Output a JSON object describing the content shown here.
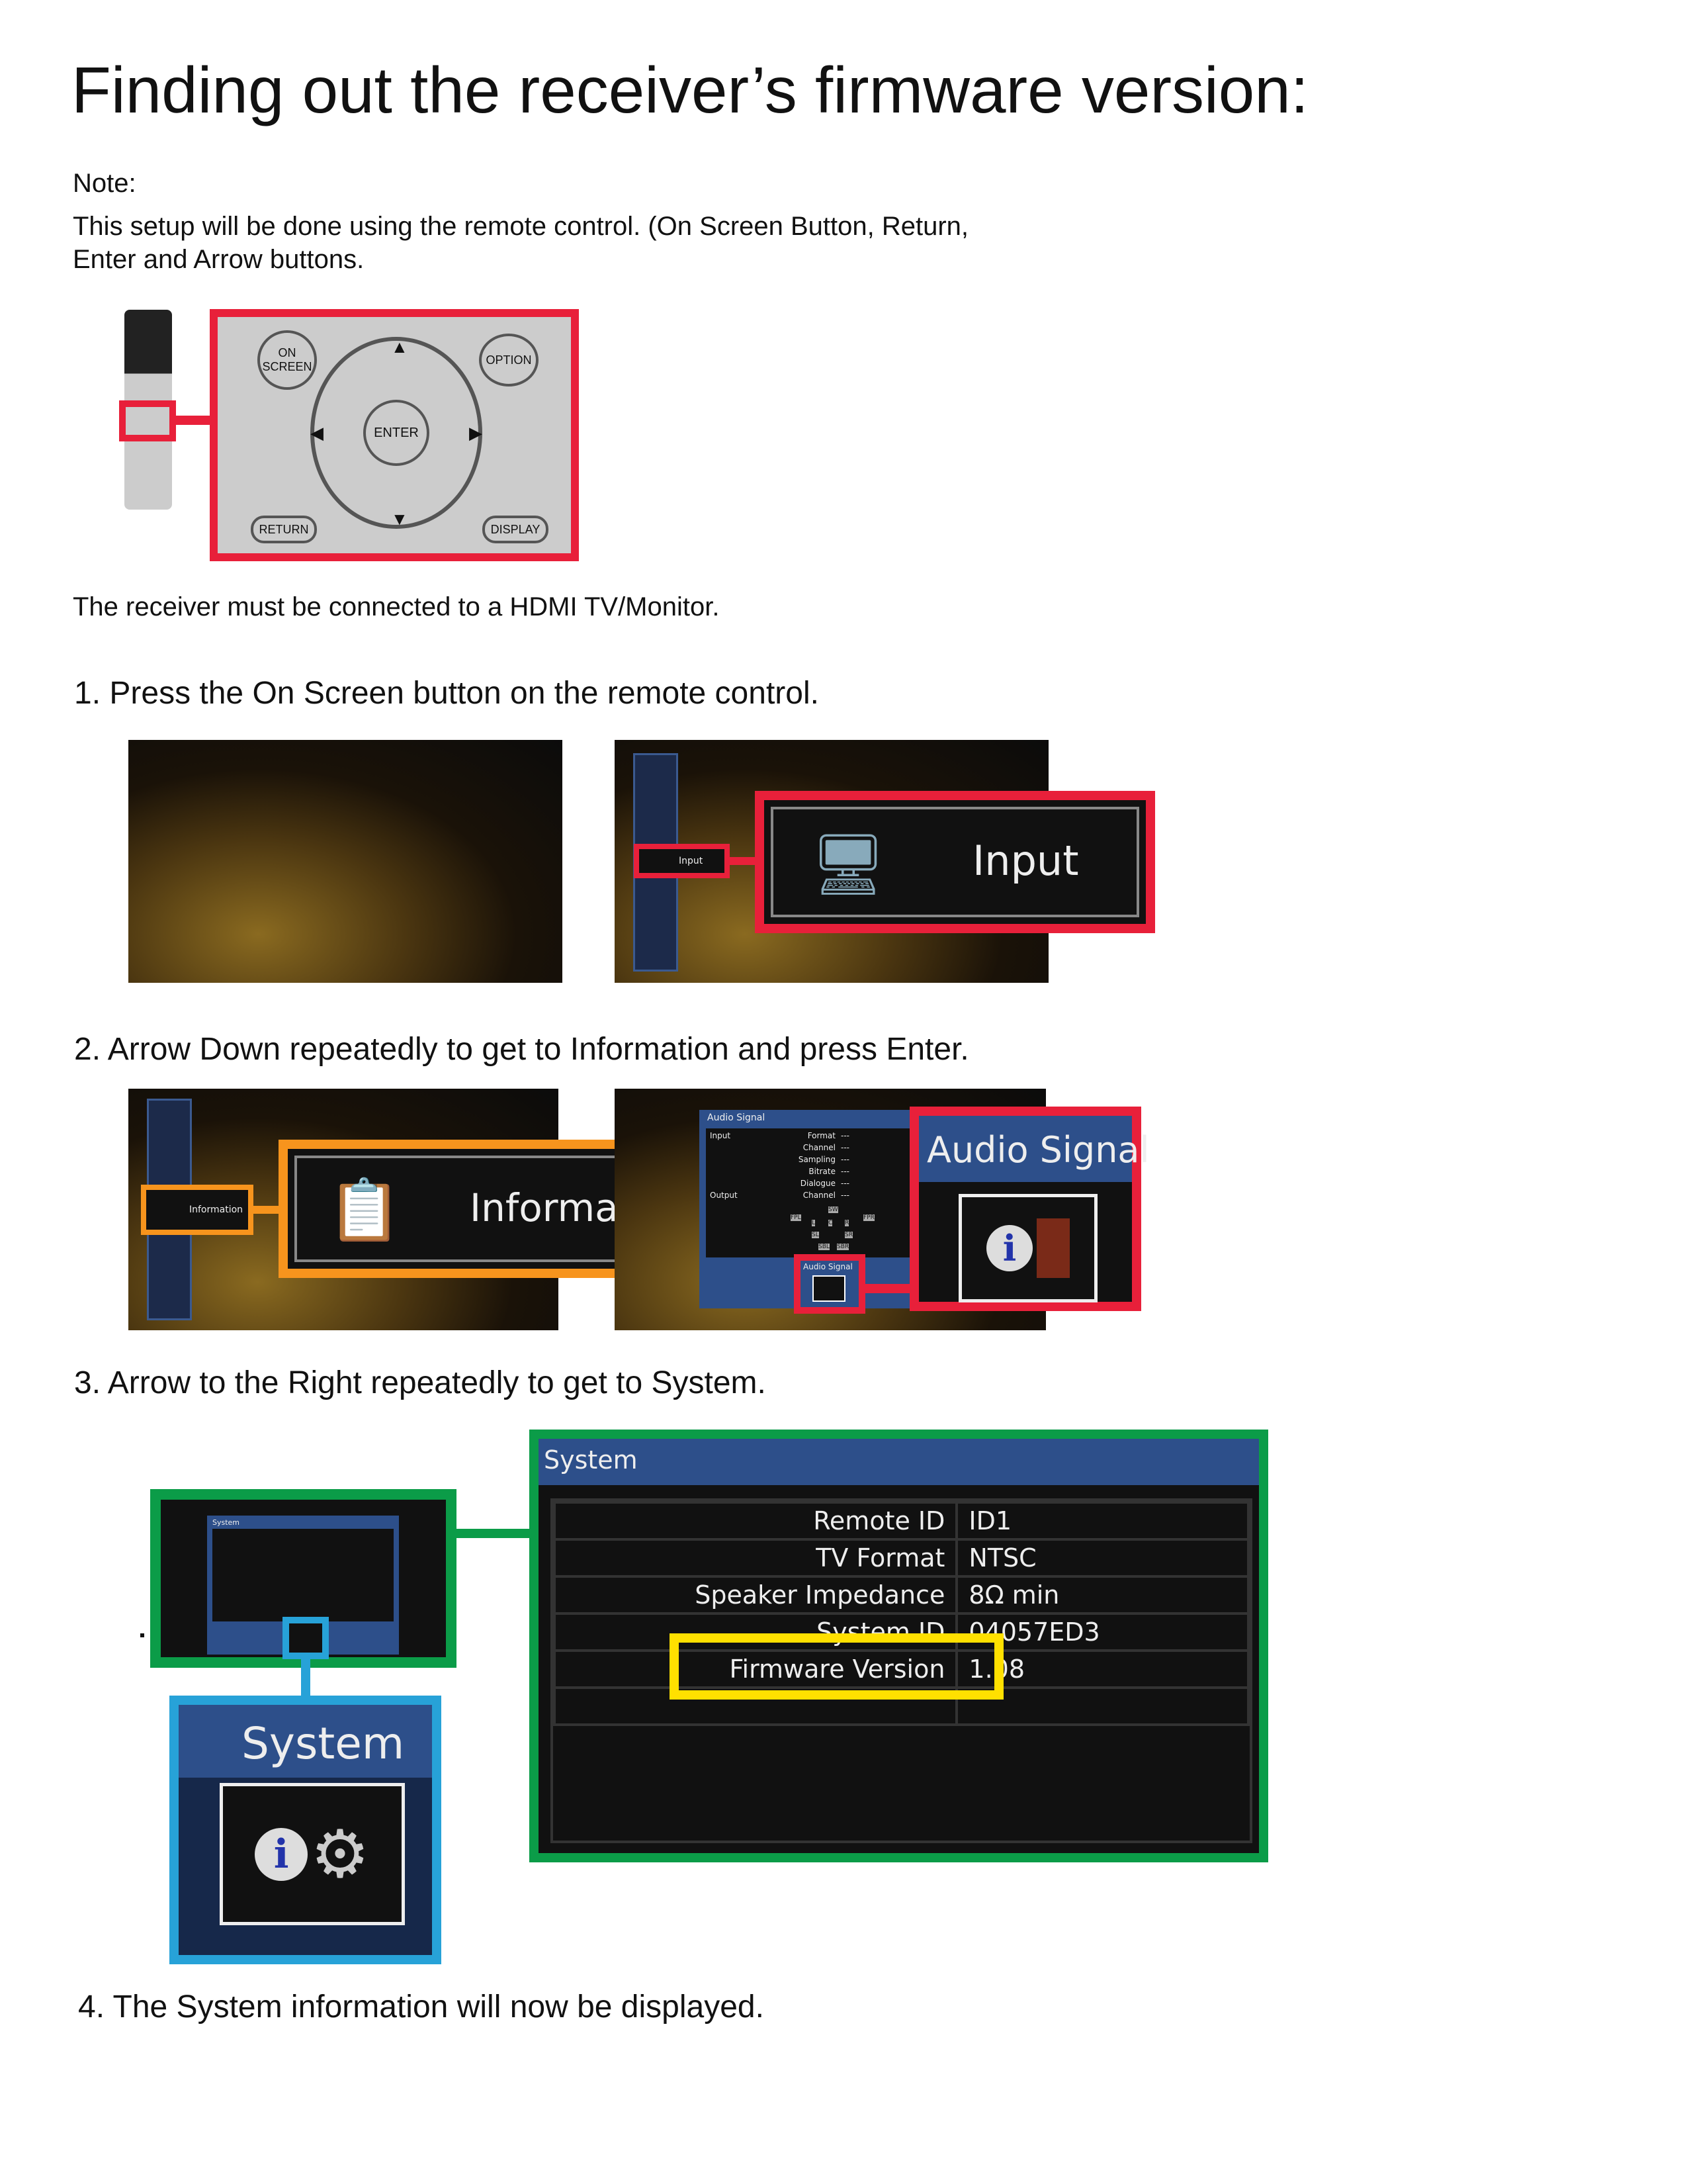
{
  "title": "Finding out the receiver’s firmware version:",
  "note_label": "Note:",
  "note_line1": "This setup will be done using the remote control.  (On Screen Button, Return,",
  "note_line2": "Enter and Arrow buttons.",
  "remote": {
    "on_screen": "ON SCREEN",
    "option": "OPTION",
    "enter": "ENTER",
    "return": "RETURN",
    "display": "DISPLAY"
  },
  "hdmi_note": "The receiver must be connected to a HDMI TV/Monitor.",
  "steps": [
    "1.  Press the On Screen button on the remote control.",
    "2.  Arrow Down repeatedly to get to Information and press Enter.",
    "3.  Arrow to the Right repeatedly to get to System.",
    "4. The System information will now be displayed."
  ],
  "step1": {
    "menu_small": "Input",
    "menu_big": "Input"
  },
  "step2": {
    "menu_small": "Information",
    "menu_big": "Information",
    "audio_title": "Audio Signal",
    "input_label": "Input",
    "output_label": "Output",
    "rows": [
      [
        "Format",
        "---"
      ],
      [
        "Channel",
        "---"
      ],
      [
        "Sampling",
        "---"
      ],
      [
        "Bitrate",
        "---"
      ],
      [
        "Dialogue",
        "---"
      ]
    ],
    "output_row": [
      "Channel",
      "---"
    ],
    "speakers": [
      "SW",
      "FPL",
      "L",
      "C",
      "R",
      "FPR",
      "SL",
      "SR",
      "SBL",
      "SBR"
    ],
    "tab_small": "Audio Signal",
    "tab_big": "Audio Signal"
  },
  "step3": {
    "system_title": "System",
    "tab_big": "System",
    "rows": [
      [
        "Remote ID",
        "ID1"
      ],
      [
        "TV Format",
        "NTSC"
      ],
      [
        "Speaker Impedance",
        "8Ω min"
      ],
      [
        "System ID",
        "04057ED3"
      ],
      [
        "Firmware Version",
        "1.08"
      ]
    ]
  },
  "colors": {
    "red": "#e8203a",
    "orange": "#f7941d",
    "green": "#0b9c48",
    "blue": "#27a2d8",
    "yellow": "#ffe000",
    "panel_blue": "#2d4f8a"
  }
}
